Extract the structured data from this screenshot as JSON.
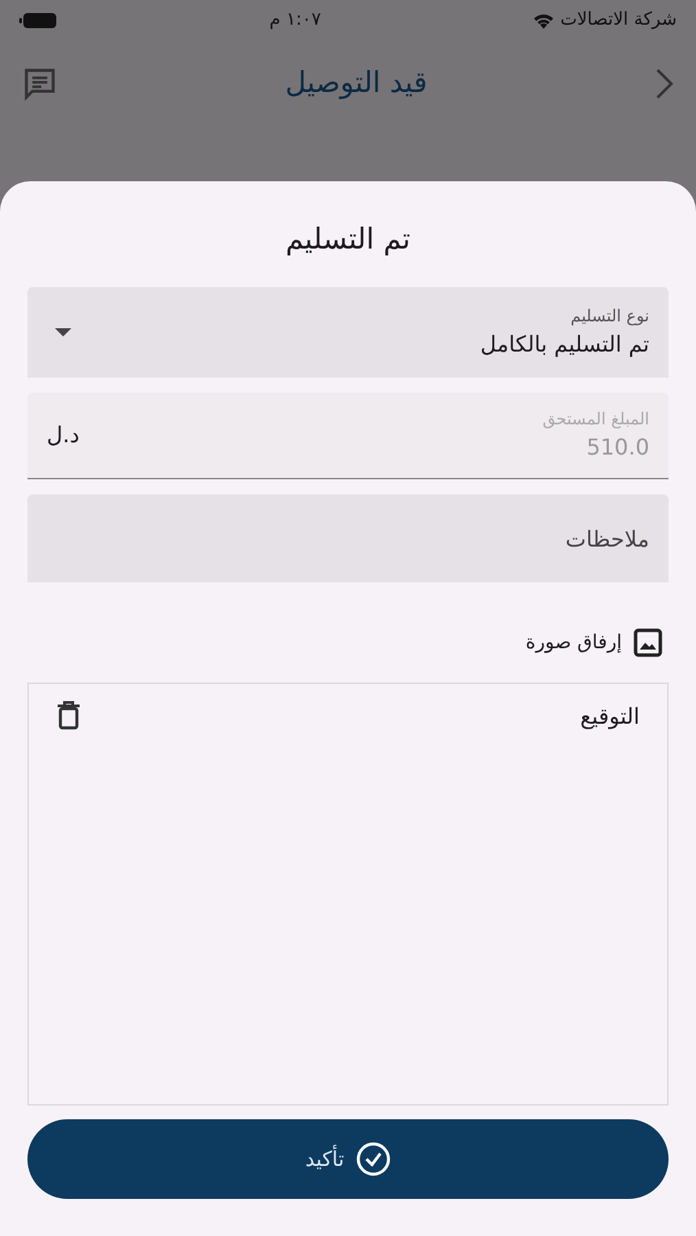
{
  "status_bar": {
    "carrier": "شركة الاتصالات",
    "time": "١:٠٧ م"
  },
  "app_bar": {
    "title": "قيد التوصيل"
  },
  "sheet": {
    "title": "تم التسليم",
    "fields": [
      {
        "kind": "dropdown",
        "label": "نوع التسليم",
        "value": "تم التسليم بالكامل",
        "disabled": false
      },
      {
        "kind": "amount",
        "label": "المبلغ المستحق",
        "value": "510.0",
        "suffix": "د.ل",
        "disabled": true
      },
      {
        "kind": "text",
        "placeholder": "ملاحظات"
      }
    ],
    "attach": {
      "label": "إرفاق صورة"
    },
    "signature": {
      "label": "التوقيع"
    },
    "confirm": {
      "label": "تأكيد"
    }
  }
}
